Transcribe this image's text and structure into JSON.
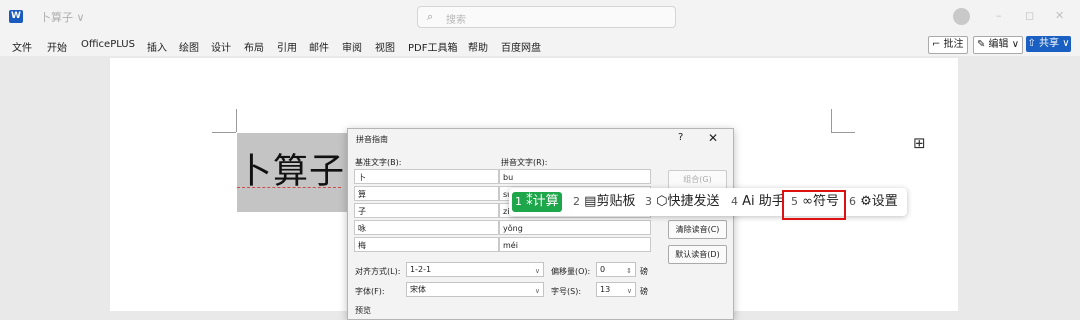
{
  "window": {
    "doc_title": "卜算子 ∨",
    "search_placeholder": "搜索",
    "controls": [
      "–",
      "◻",
      "✕"
    ]
  },
  "menu": [
    "文件",
    "开始",
    "OfficePLUS",
    "插入",
    "绘图",
    "设计",
    "布局",
    "引用",
    "邮件",
    "审阅",
    "视图",
    "PDF工具箱",
    "帮助",
    "百度网盘"
  ],
  "ribbon_actions": {
    "comment": "⌐ 批注",
    "edit": "✎ 编辑 ∨",
    "share": "⇧ 共享 ∨"
  },
  "document": {
    "heading": "卜算子"
  },
  "dialog": {
    "title": "拼音指南",
    "help": "?",
    "close": "✕",
    "base_label": "基准文字(B):",
    "ruby_label": "拼音文字(R):",
    "rows": [
      {
        "base": "卜",
        "ruby": "bu"
      },
      {
        "base": "算",
        "ruby": "su"
      },
      {
        "base": "子",
        "ruby": "zi"
      },
      {
        "base": "咏",
        "ruby": "yǒng"
      },
      {
        "base": "梅",
        "ruby": "méi"
      }
    ],
    "buttons": {
      "group": "组合(G)",
      "clear": "清除读音(C)",
      "default": "默认读音(D)"
    },
    "align_label": "对齐方式(L):",
    "align_value": "1-2-1",
    "offset_label": "偏移量(O):",
    "offset_value": "0",
    "unit1": "磅",
    "font_label": "字体(F):",
    "font_value": "宋体",
    "size_label": "字号(S):",
    "size_value": "13",
    "unit2": "磅",
    "preview_label": "预览"
  },
  "floating_toolbar": {
    "items": [
      {
        "num": "1",
        "icon": "⁑",
        "label": "计算"
      },
      {
        "num": "2",
        "icon": "▤",
        "label": "剪贴板"
      },
      {
        "num": "3",
        "icon": "⬡",
        "label": "快捷发送"
      },
      {
        "num": "4",
        "icon": "Ai",
        "label": "助手"
      },
      {
        "num": "5",
        "icon": "∞",
        "label": "符号"
      },
      {
        "num": "6",
        "icon": "⚙",
        "label": "设置"
      }
    ]
  }
}
